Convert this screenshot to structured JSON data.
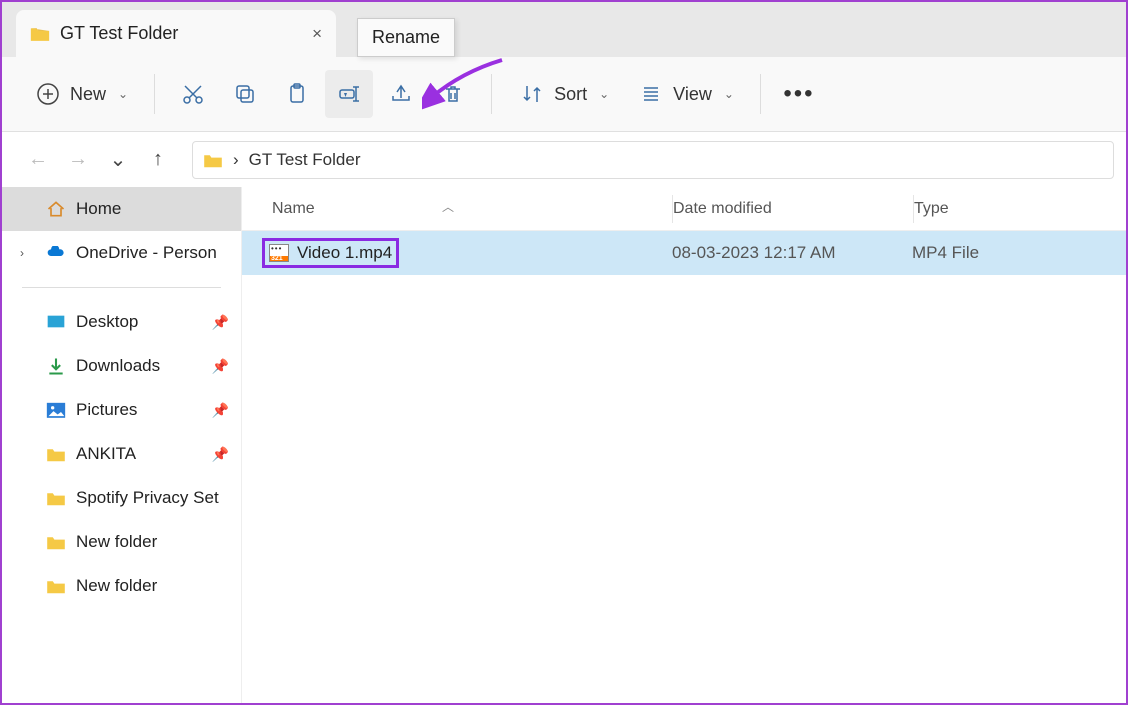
{
  "tab": {
    "title": "GT Test Folder"
  },
  "tooltip": {
    "label": "Rename"
  },
  "toolbar": {
    "new": "New",
    "sort": "Sort",
    "view": "View"
  },
  "breadcrumb": {
    "path": "GT Test Folder"
  },
  "sidebar": {
    "home": "Home",
    "onedrive": "OneDrive - Person",
    "items": [
      {
        "label": "Desktop",
        "pinned": true
      },
      {
        "label": "Downloads",
        "pinned": true
      },
      {
        "label": "Pictures",
        "pinned": true
      },
      {
        "label": "ANKITA",
        "pinned": true
      },
      {
        "label": "Spotify Privacy Set",
        "pinned": false
      },
      {
        "label": "New folder",
        "pinned": false
      },
      {
        "label": "New folder",
        "pinned": false
      }
    ]
  },
  "columns": {
    "name": "Name",
    "date": "Date modified",
    "type": "Type"
  },
  "rows": [
    {
      "name": "Video 1.mp4",
      "date": "08-03-2023 12:17 AM",
      "type": "MP4 File",
      "selected": true
    }
  ]
}
